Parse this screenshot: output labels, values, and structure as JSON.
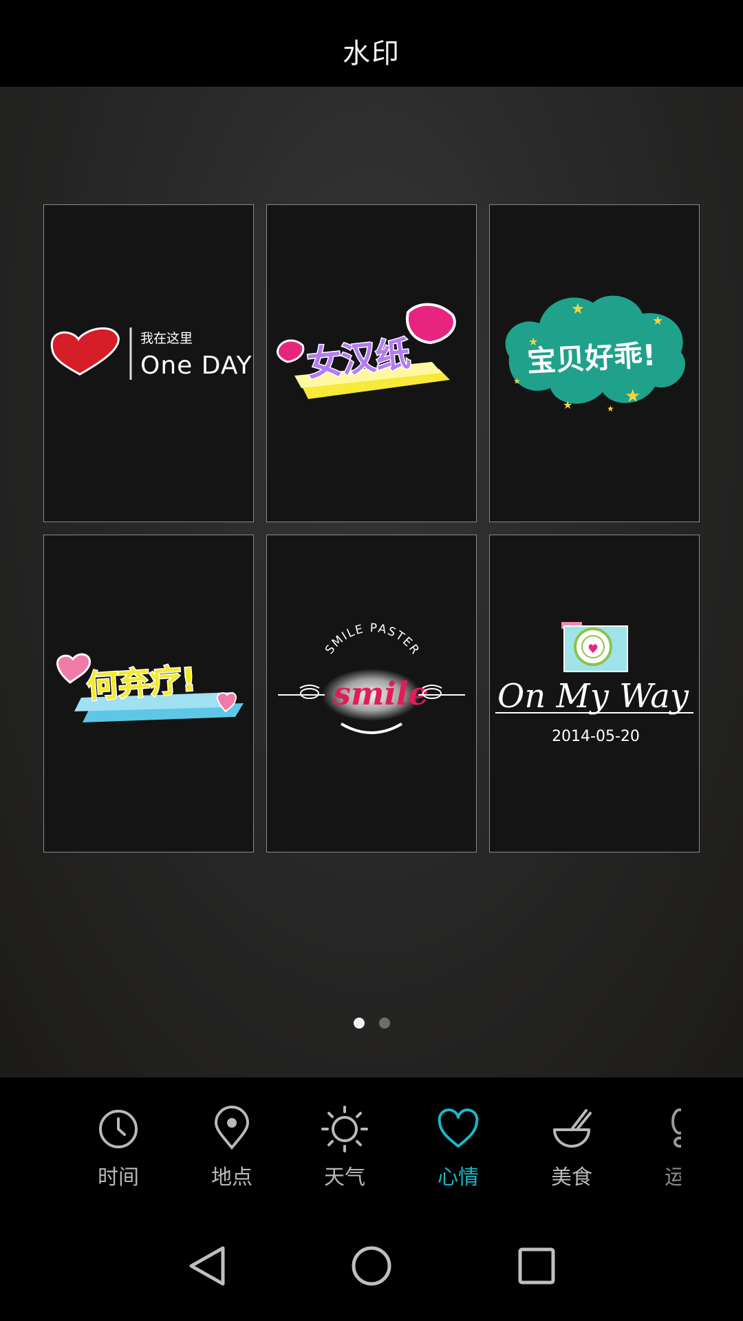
{
  "header": {
    "title": "水印"
  },
  "watermarks": [
    {
      "name": "one-day",
      "cn_text": "我在这里",
      "en_text": "One DAY"
    },
    {
      "name": "nv-han-zi",
      "text": "女汉纸"
    },
    {
      "name": "bao-bei-hao-guai",
      "text": "宝贝好乖!"
    },
    {
      "name": "he-qi-liao",
      "text": "何弃疗!"
    },
    {
      "name": "smile-paster",
      "arc_text": "SMILE PASTER",
      "text": "smile"
    },
    {
      "name": "on-my-way",
      "text": "On My Way",
      "date": "2014-05-20"
    }
  ],
  "pager": {
    "pages": 2,
    "current": 0
  },
  "tabs": [
    {
      "label": "时间",
      "icon": "clock-icon"
    },
    {
      "label": "地点",
      "icon": "location-pin-icon"
    },
    {
      "label": "天气",
      "icon": "sun-icon"
    },
    {
      "label": "心情",
      "icon": "heart-icon",
      "active": true
    },
    {
      "label": "美食",
      "icon": "bowl-icon"
    },
    {
      "label": "运",
      "icon": "footprint-icon"
    }
  ],
  "colors": {
    "accent": "#19b8c9",
    "tab_inactive": "#b9b9b9",
    "background": "#000000"
  },
  "nav": [
    "back-icon",
    "home-icon",
    "recents-icon"
  ]
}
